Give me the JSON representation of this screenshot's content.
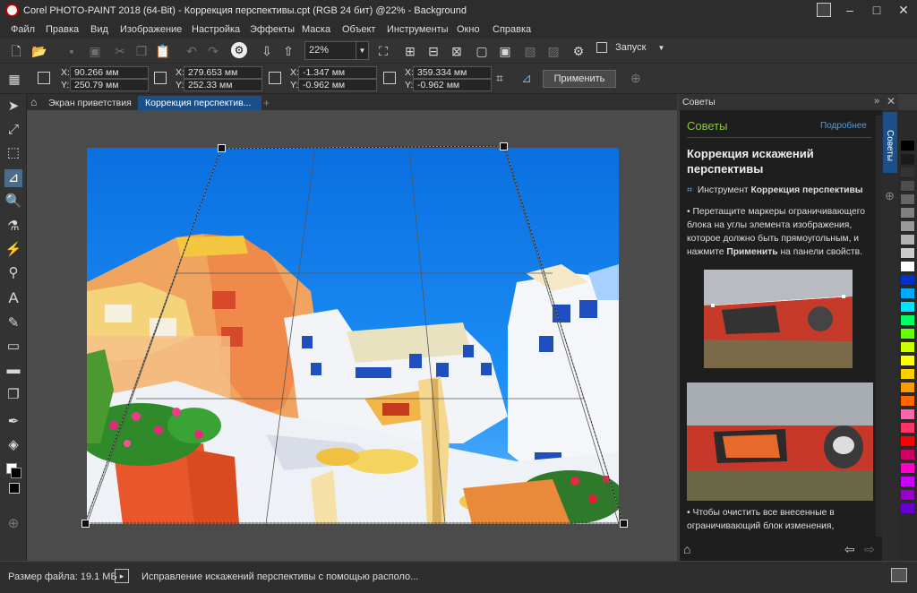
{
  "window": {
    "title": "Corel PHOTO-PAINT 2018 (64-Bit) - Коррекция перспективы.cpt (RGB 24 бит) @22% - Background",
    "minimize": "–",
    "maximize": "□",
    "close": "✕"
  },
  "menu": [
    "Файл",
    "Правка",
    "Вид",
    "Изображение",
    "Настройка",
    "Эффекты",
    "Маска",
    "Объект",
    "Инструменты",
    "Окно",
    "Справка"
  ],
  "toolbar": {
    "zoom": "22%",
    "launch_label": "Запуск"
  },
  "property_bar": {
    "pos1": {
      "x": "90.266 мм",
      "y": "250.79 мм"
    },
    "pos2": {
      "x": "279.653 мм",
      "y": "252.33 мм"
    },
    "pos3": {
      "x": "-1.347 мм",
      "y": "-0.962 мм"
    },
    "pos4": {
      "x": "359.334 мм",
      "y": "-0.962 мм"
    },
    "x_label": "X:",
    "y_label": "Y:",
    "apply_label": "Применить"
  },
  "tabs": [
    {
      "label": "Экран приветствия"
    },
    {
      "label": "Коррекция перспектив..."
    }
  ],
  "tips": {
    "docker_title": "Советы",
    "heading_green": "Советы",
    "more_link": "Подробнее",
    "title": "Коррекция искажений перспективы",
    "tool_prefix": "Инструмент ",
    "tool_name": "Коррекция перспективы",
    "bullet1_a": "• Перетащите маркеры ограничивающего блока на углы элемента изображения, которое должно быть прямоугольным, и нажмите ",
    "bullet1_bold": "Применить",
    "bullet1_b": " на панели свойств.",
    "bullet2": "• Чтобы очистить все внесенные в ограничивающий блок изменения,",
    "vtab_label": "Советы"
  },
  "status": {
    "file_size": "Размер файла: 19.1 МБ",
    "message": "Исправление искажений перспективы с помощью располо..."
  },
  "palette_colors": [
    "#000000",
    "#1a1a1a",
    "#333333",
    "#4d4d4d",
    "#666666",
    "#808080",
    "#999999",
    "#b3b3b3",
    "#cccccc",
    "#ffffff",
    "#0033cc",
    "#00aaff",
    "#00e5ff",
    "#00ff66",
    "#66ff00",
    "#ccff00",
    "#ffff00",
    "#ffcc00",
    "#ff9900",
    "#ff6600",
    "#ff66aa",
    "#ff3366",
    "#ff0000",
    "#cc0066",
    "#ff00cc",
    "#cc00ff",
    "#9900cc",
    "#6600cc"
  ]
}
